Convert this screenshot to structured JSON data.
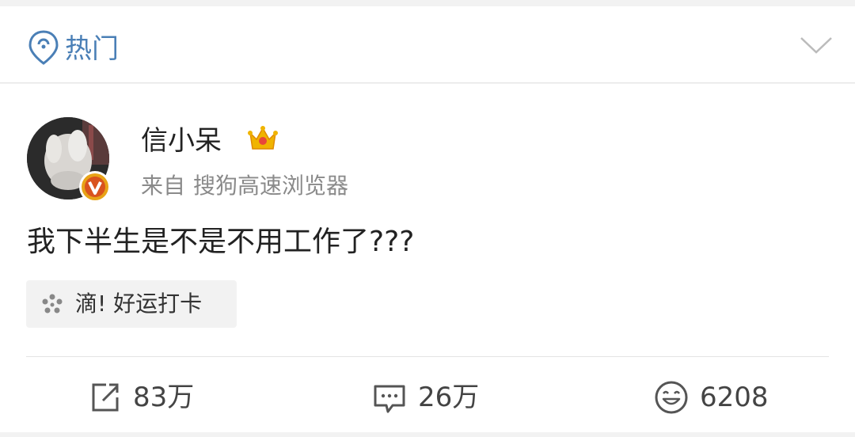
{
  "header": {
    "title": "热门",
    "icon": "location-pin-wifi-icon"
  },
  "post": {
    "username": "信小呆",
    "source_prefix": "来自",
    "source_app": "搜狗高速浏览器",
    "text": "我下半生是不是不用工作了???",
    "topic": "滴! 好运打卡",
    "badge_letter": "v"
  },
  "actions": {
    "repost": "83万",
    "comment": "26万",
    "like": "6208"
  },
  "colors": {
    "accent": "#4a7fb6",
    "badge": "#e8a317",
    "crown": "#f0b400"
  }
}
